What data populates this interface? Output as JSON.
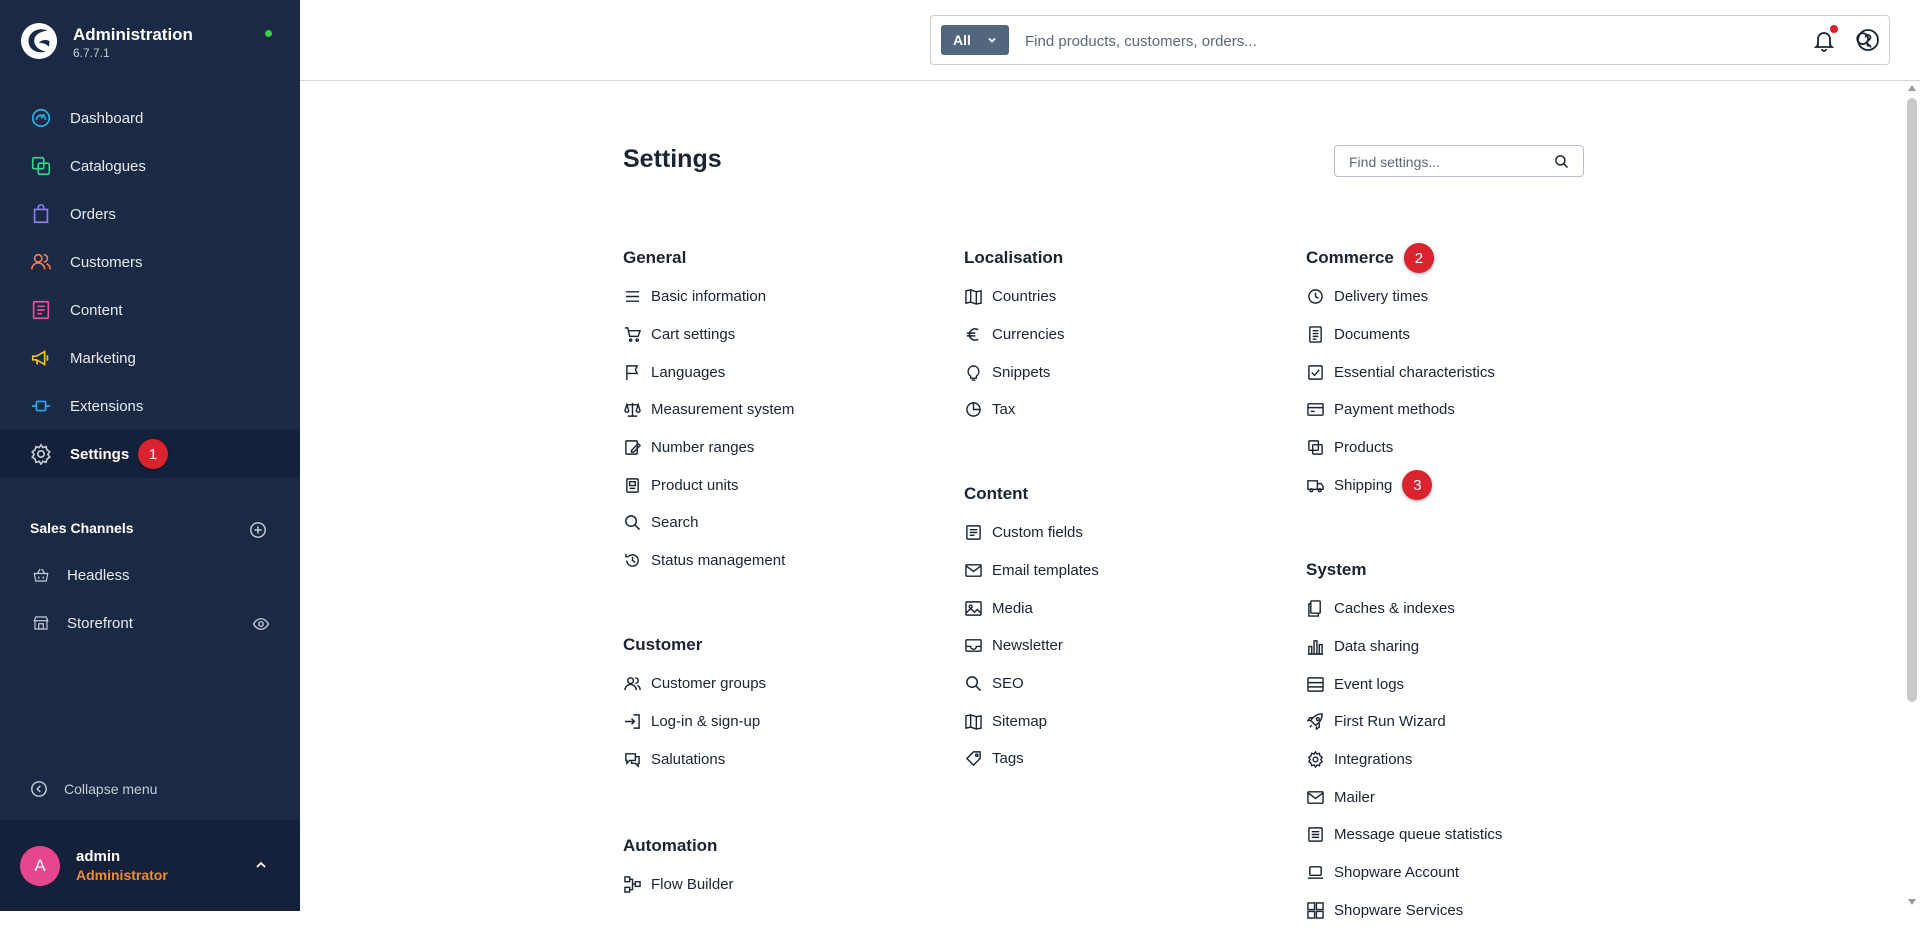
{
  "brand": {
    "title": "Administration",
    "version": "6.7.7.1"
  },
  "nav": {
    "items": [
      {
        "label": "Dashboard",
        "icon": "dashboard-icon",
        "color": "#29b3e6"
      },
      {
        "label": "Catalogues",
        "icon": "catalogues-icon",
        "color": "#35d28b"
      },
      {
        "label": "Orders",
        "icon": "orders-icon",
        "color": "#8c7df0"
      },
      {
        "label": "Customers",
        "icon": "customers-icon",
        "color": "#f27e59"
      },
      {
        "label": "Content",
        "icon": "content-icon",
        "color": "#ef4e9b"
      },
      {
        "label": "Marketing",
        "icon": "marketing-icon",
        "color": "#f5c518"
      },
      {
        "label": "Extensions",
        "icon": "extensions-icon",
        "color": "#2aa8f2"
      },
      {
        "label": "Settings",
        "icon": "settings-icon",
        "color": "#c7ccd6",
        "marker": "1"
      }
    ]
  },
  "sales_channels": {
    "title": "Sales Channels",
    "items": [
      {
        "label": "Headless",
        "icon": "basket-icon"
      },
      {
        "label": "Storefront",
        "icon": "storefront-icon"
      }
    ]
  },
  "collapse_label": "Collapse menu",
  "user": {
    "initial": "A",
    "name": "admin",
    "role": "Administrator"
  },
  "search": {
    "type": "All",
    "placeholder": "Find products, customers, orders..."
  },
  "page": {
    "title": "Settings",
    "search_placeholder": "Find settings..."
  },
  "groups": {
    "general": {
      "title": "General",
      "items": [
        {
          "label": "Basic information",
          "icon": "list-icon"
        },
        {
          "label": "Cart settings",
          "icon": "cart-icon"
        },
        {
          "label": "Languages",
          "icon": "flag-icon"
        },
        {
          "label": "Measurement system",
          "icon": "scale-icon"
        },
        {
          "label": "Number ranges",
          "icon": "number-ranges-icon"
        },
        {
          "label": "Product units",
          "icon": "product-units-icon"
        },
        {
          "label": "Search",
          "icon": "search-icon"
        },
        {
          "label": "Status management",
          "icon": "history-icon"
        }
      ]
    },
    "customer": {
      "title": "Customer",
      "items": [
        {
          "label": "Customer groups",
          "icon": "users-icon"
        },
        {
          "label": "Log-in & sign-up",
          "icon": "sign-in-icon"
        },
        {
          "label": "Salutations",
          "icon": "chat-icon"
        }
      ]
    },
    "automation": {
      "title": "Automation",
      "items": [
        {
          "label": "Flow Builder",
          "icon": "flow-icon"
        }
      ]
    },
    "localisation": {
      "title": "Localisation",
      "items": [
        {
          "label": "Countries",
          "icon": "map-icon"
        },
        {
          "label": "Currencies",
          "icon": "euro-icon"
        },
        {
          "label": "Snippets",
          "icon": "snippets-icon"
        },
        {
          "label": "Tax",
          "icon": "pie-icon"
        }
      ]
    },
    "content": {
      "title": "Content",
      "items": [
        {
          "label": "Custom fields",
          "icon": "custom-fields-icon"
        },
        {
          "label": "Email templates",
          "icon": "envelope-icon"
        },
        {
          "label": "Media",
          "icon": "image-icon"
        },
        {
          "label": "Newsletter",
          "icon": "inbox-icon"
        },
        {
          "label": "SEO",
          "icon": "search-icon"
        },
        {
          "label": "Sitemap",
          "icon": "map-icon"
        },
        {
          "label": "Tags",
          "icon": "tag-icon"
        }
      ]
    },
    "commerce": {
      "title": "Commerce",
      "marker": "2",
      "items": [
        {
          "label": "Delivery times",
          "icon": "clock-icon"
        },
        {
          "label": "Documents",
          "icon": "document-icon"
        },
        {
          "label": "Essential characteristics",
          "icon": "checkbox-icon"
        },
        {
          "label": "Payment methods",
          "icon": "credit-card-icon"
        },
        {
          "label": "Products",
          "icon": "products-icon"
        },
        {
          "label": "Shipping",
          "icon": "truck-icon",
          "marker": "3"
        }
      ]
    },
    "system": {
      "title": "System",
      "items": [
        {
          "label": "Caches & indexes",
          "icon": "caches-icon"
        },
        {
          "label": "Data sharing",
          "icon": "bar-chart-icon"
        },
        {
          "label": "Event logs",
          "icon": "event-logs-icon"
        },
        {
          "label": "First Run Wizard",
          "icon": "rocket-icon"
        },
        {
          "label": "Integrations",
          "icon": "gear-icon"
        },
        {
          "label": "Mailer",
          "icon": "envelope-icon"
        },
        {
          "label": "Message queue statistics",
          "icon": "list-box-icon"
        },
        {
          "label": "Shopware Account",
          "icon": "laptop-icon"
        },
        {
          "label": "Shopware Services",
          "icon": "services-icon"
        }
      ]
    }
  }
}
